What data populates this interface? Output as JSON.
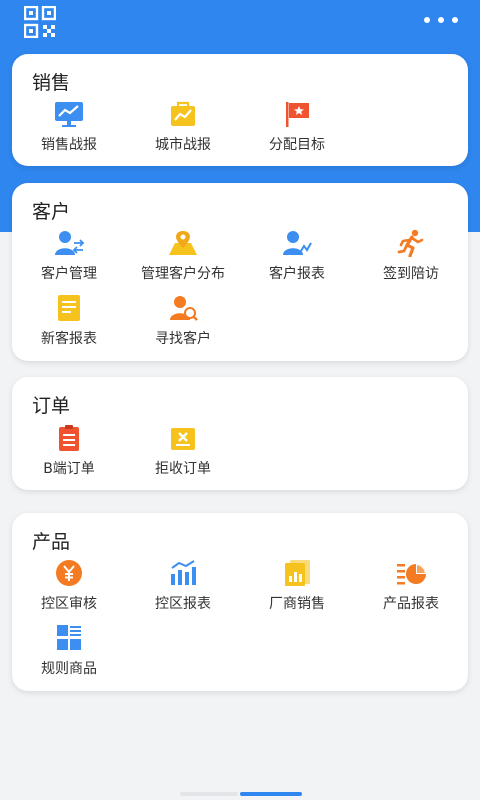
{
  "header": {
    "qr_icon": "qr-code-icon",
    "more_icon": "more-dots-icon"
  },
  "sections": {
    "sales": {
      "title": "销售",
      "items": [
        {
          "label": "销售战报",
          "icon": "sales-report-icon"
        },
        {
          "label": "城市战报",
          "icon": "city-report-icon"
        },
        {
          "label": "分配目标",
          "icon": "flag-target-icon"
        }
      ]
    },
    "customer": {
      "title": "客户",
      "items": [
        {
          "label": "客户管理",
          "icon": "customer-manage-icon"
        },
        {
          "label": "管理客户分布",
          "icon": "map-location-icon"
        },
        {
          "label": "客户报表",
          "icon": "customer-report-icon"
        },
        {
          "label": "签到陪访",
          "icon": "running-person-icon"
        },
        {
          "label": "新客报表",
          "icon": "new-customer-report-icon"
        },
        {
          "label": "寻找客户",
          "icon": "find-customer-icon"
        }
      ]
    },
    "order": {
      "title": "订单",
      "items": [
        {
          "label": "B端订单",
          "icon": "clipboard-order-icon"
        },
        {
          "label": "拒收订单",
          "icon": "reject-order-icon"
        }
      ]
    },
    "product": {
      "title": "产品",
      "items": [
        {
          "label": "控区审核",
          "icon": "yen-audit-icon"
        },
        {
          "label": "控区报表",
          "icon": "bar-chart-icon"
        },
        {
          "label": "厂商销售",
          "icon": "vendor-sales-icon"
        },
        {
          "label": "产品报表",
          "icon": "pie-report-icon"
        },
        {
          "label": "规则商品",
          "icon": "grid-goods-icon"
        }
      ]
    }
  },
  "colors": {
    "brand_blue": "#2f86ee",
    "icon_yellow": "#f6c21d",
    "icon_orange": "#f47b22",
    "icon_red": "#ef5330"
  }
}
